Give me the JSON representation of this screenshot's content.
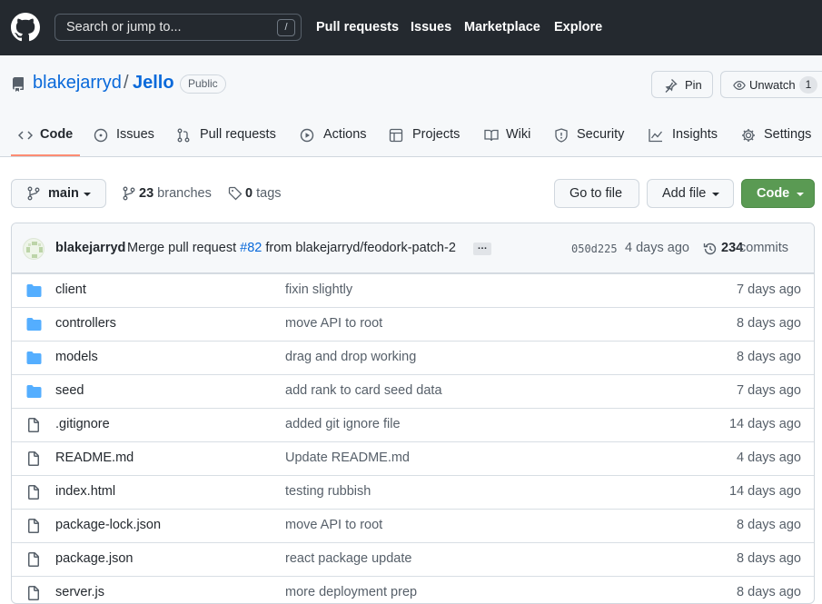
{
  "header": {
    "search_placeholder": "Search or jump to...",
    "search_key": "/",
    "nav": [
      "Pull requests",
      "Issues",
      "Marketplace",
      "Explore"
    ]
  },
  "repo": {
    "owner": "blakejarryd",
    "separator": "/",
    "name": "Jello",
    "visibility": "Public",
    "pin_label": "Pin",
    "watch_label": "Unwatch",
    "watch_count": "1"
  },
  "tabs": [
    {
      "label": "Code",
      "icon": "code-icon",
      "selected": true
    },
    {
      "label": "Issues",
      "icon": "issue-icon"
    },
    {
      "label": "Pull requests",
      "icon": "pull-request-icon"
    },
    {
      "label": "Actions",
      "icon": "play-icon"
    },
    {
      "label": "Projects",
      "icon": "table-icon"
    },
    {
      "label": "Wiki",
      "icon": "book-icon"
    },
    {
      "label": "Security",
      "icon": "shield-icon"
    },
    {
      "label": "Insights",
      "icon": "graph-icon"
    },
    {
      "label": "Settings",
      "icon": "gear-icon"
    }
  ],
  "branchbar": {
    "branch": "main",
    "branches_count": "23",
    "branches_label": "branches",
    "tags_count": "0",
    "tags_label": "tags",
    "go_to_file": "Go to file",
    "add_file": "Add file",
    "code": "Code"
  },
  "latest_commit": {
    "author": "blakejarryd",
    "message_prefix": "Merge pull request",
    "pr": "#82",
    "message_suffix": "from blakejarryd/feodork-patch-2",
    "ellipsis": "…",
    "sha": "050d225",
    "time": "4 days ago",
    "commits_count": "234",
    "commits_label": "commits"
  },
  "files": [
    {
      "type": "folder",
      "name": "client",
      "message": "fixin slightly",
      "age": "7 days ago"
    },
    {
      "type": "folder",
      "name": "controllers",
      "message": "move API to root",
      "age": "8 days ago"
    },
    {
      "type": "folder",
      "name": "models",
      "message": "drag and drop working",
      "age": "8 days ago"
    },
    {
      "type": "folder",
      "name": "seed",
      "message": "add rank to card seed data",
      "age": "7 days ago"
    },
    {
      "type": "file",
      "name": ".gitignore",
      "message": "added git ignore file",
      "age": "14 days ago"
    },
    {
      "type": "file",
      "name": "README.md",
      "message": "Update README.md",
      "age": "4 days ago"
    },
    {
      "type": "file",
      "name": "index.html",
      "message": "testing rubbish",
      "age": "14 days ago"
    },
    {
      "type": "file",
      "name": "package-lock.json",
      "message": "move API to root",
      "age": "8 days ago"
    },
    {
      "type": "file",
      "name": "package.json",
      "message": "react package update",
      "age": "8 days ago"
    },
    {
      "type": "file",
      "name": "server.js",
      "message": "more deployment prep",
      "age": "8 days ago"
    }
  ],
  "colors": {
    "header_bg": "#24292f",
    "link": "#0969da",
    "code_button": "#5a9a53",
    "tab_underline": "#fd8c73",
    "folder": "#54aeff"
  }
}
